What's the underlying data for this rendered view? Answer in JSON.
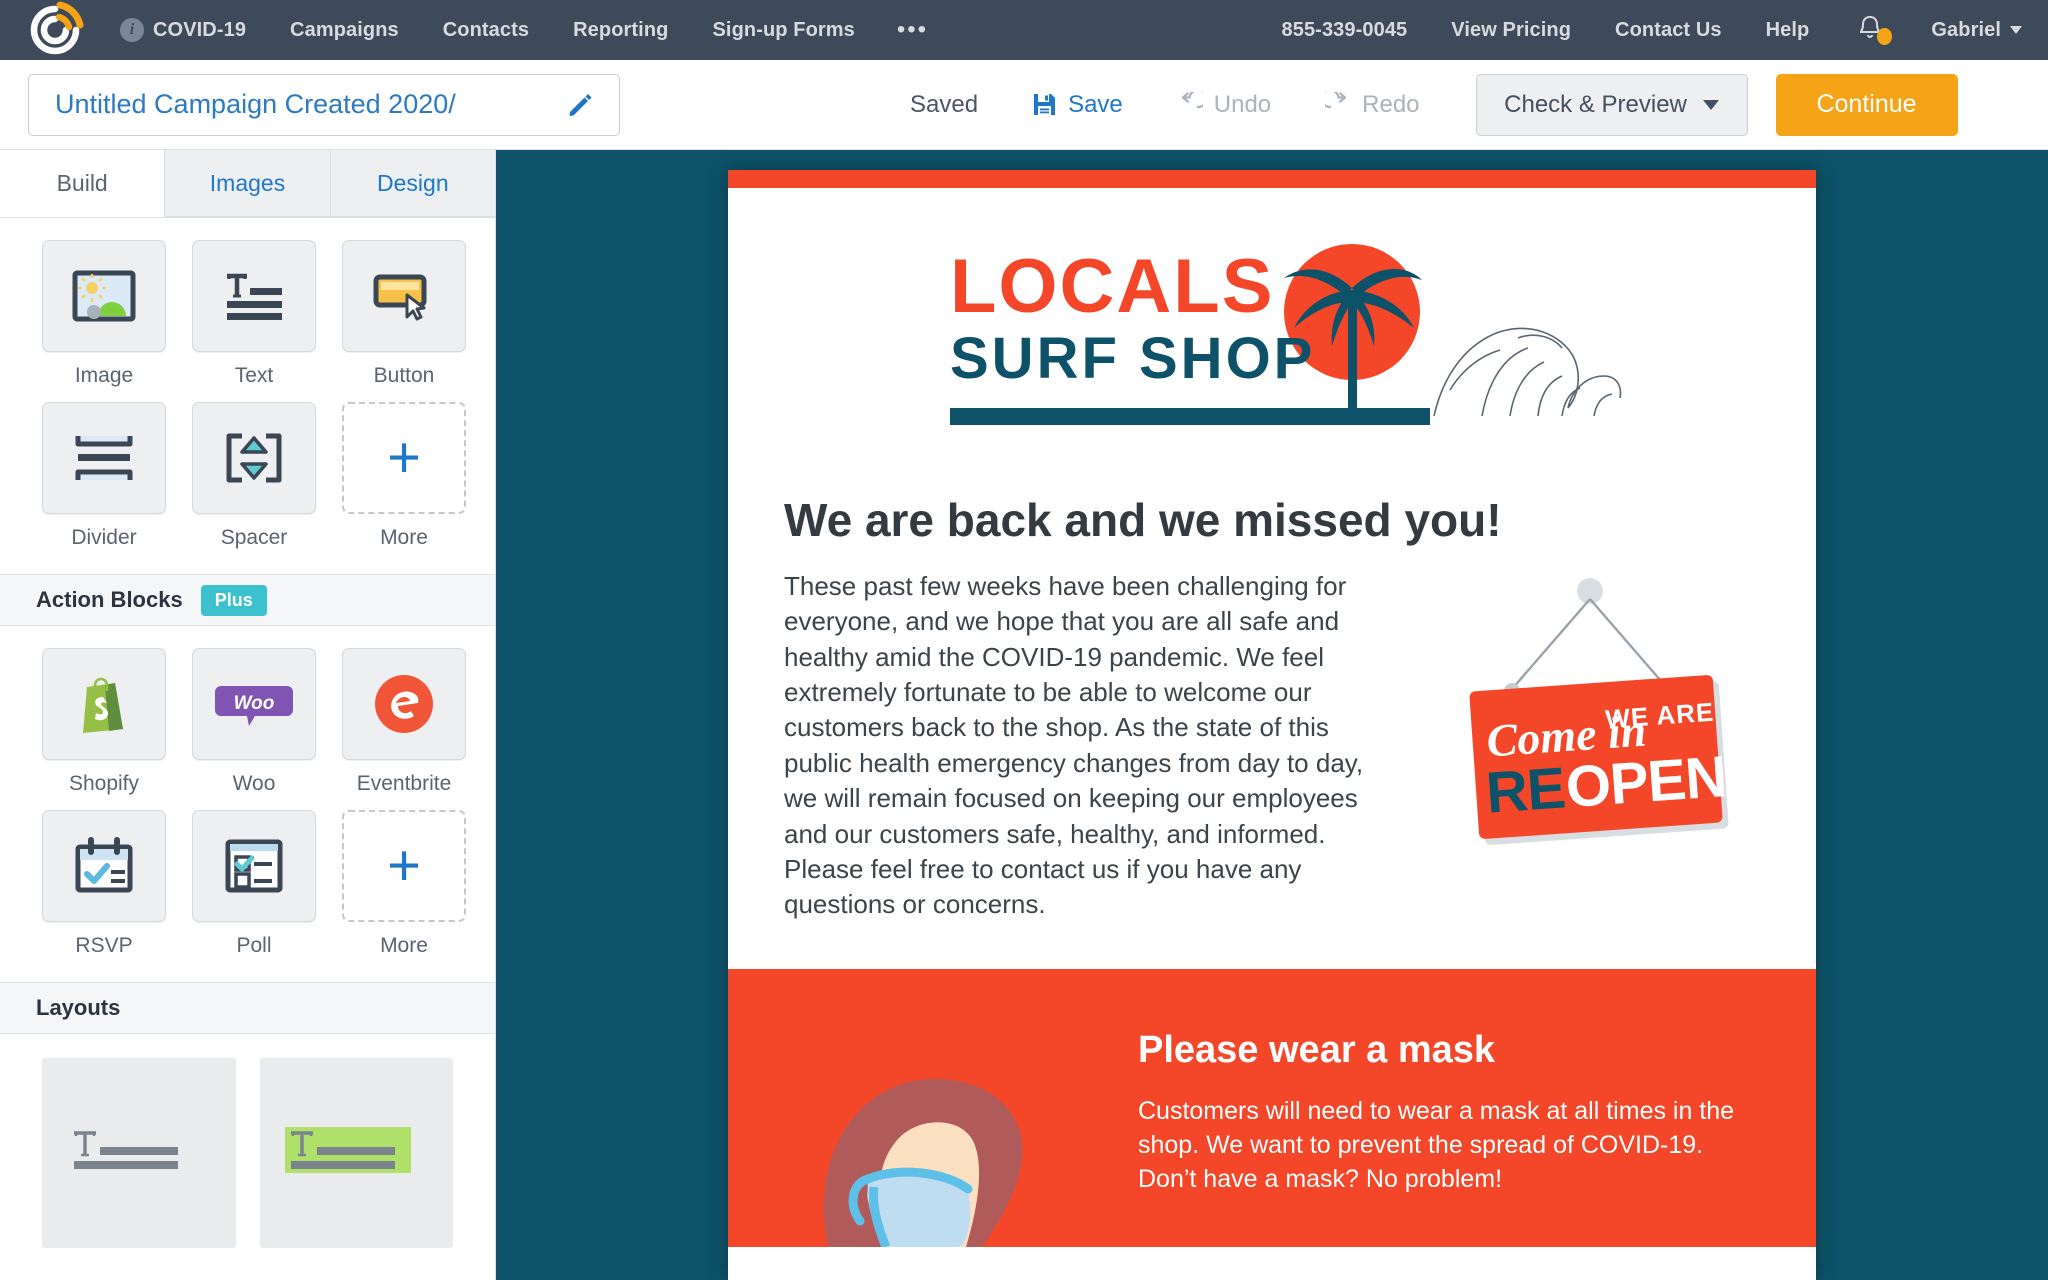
{
  "topnav": {
    "logo_icon": "constant-contact-spiral-logo",
    "left_items": [
      {
        "label": "COVID-19",
        "icon": "info-circle-icon"
      },
      {
        "label": "Campaigns"
      },
      {
        "label": "Contacts"
      },
      {
        "label": "Reporting"
      },
      {
        "label": "Sign-up Forms"
      },
      {
        "label": "•••",
        "icon": "more-menu-icon"
      }
    ],
    "right_items": [
      {
        "label": "855-339-0045"
      },
      {
        "label": "View Pricing"
      },
      {
        "label": "Contact Us"
      },
      {
        "label": "Help"
      }
    ],
    "bell_icon": "notification-bell-icon",
    "bell_has_badge": true,
    "user_name": "Gabriel",
    "bar_color": "#3E4A5A",
    "badge_color": "#F5A317"
  },
  "toolbar": {
    "campaign_title": "Untitled Campaign Created 2020/",
    "edit_icon": "pencil-icon",
    "saved_status": "Saved",
    "save_label": "Save",
    "save_icon": "floppy-disk-icon",
    "undo_label": "Undo",
    "undo_icon": "undo-arrow-icon",
    "undo_disabled": true,
    "redo_label": "Redo",
    "redo_icon": "redo-arrow-icon",
    "redo_disabled": true,
    "check_preview_label": "Check & Preview",
    "continue_label": "Continue",
    "continue_color": "#F5A317",
    "link_color": "#1F77C9"
  },
  "sidebar": {
    "tabs": [
      {
        "label": "Build",
        "active": true
      },
      {
        "label": "Images",
        "active": false
      },
      {
        "label": "Design",
        "active": false
      }
    ],
    "basic_blocks": [
      {
        "label": "Image",
        "icon": "image-block-icon"
      },
      {
        "label": "Text",
        "icon": "text-block-icon"
      },
      {
        "label": "Button",
        "icon": "button-block-icon"
      },
      {
        "label": "Divider",
        "icon": "divider-block-icon"
      },
      {
        "label": "Spacer",
        "icon": "spacer-block-icon"
      },
      {
        "label": "More",
        "icon": "plus-icon"
      }
    ],
    "action_section": {
      "title": "Action Blocks",
      "badge": "Plus",
      "badge_color": "#3CC2CE"
    },
    "action_blocks": [
      {
        "label": "Shopify",
        "icon": "shopify-bag-icon"
      },
      {
        "label": "Woo",
        "icon": "woocommerce-icon"
      },
      {
        "label": "Eventbrite",
        "icon": "eventbrite-icon"
      },
      {
        "label": "RSVP",
        "icon": "rsvp-calendar-icon"
      },
      {
        "label": "Poll",
        "icon": "poll-checklist-icon"
      },
      {
        "label": "More",
        "icon": "plus-icon"
      }
    ],
    "layouts_section": {
      "title": "Layouts"
    },
    "layouts": [
      {
        "icon": "layout-text-plain-thumbnail",
        "highlight": false
      },
      {
        "icon": "layout-text-highlighted-thumbnail",
        "highlight": true
      }
    ]
  },
  "canvas": {
    "background_color": "#0D5268",
    "email": {
      "accent_bar_color": "#F4472A",
      "logo": {
        "icon": "locals-surf-shop-logo",
        "word_top": "LOCALS",
        "word_bottom": "SURF SHOP",
        "top_color": "#F4472A",
        "bottom_color": "#0D5268"
      },
      "headline": "We are back and we missed you!",
      "paragraph": "These past few weeks have been challenging for everyone, and we hope that you are all safe and healthy amid the COVID-19 pandemic. We feel extremely fortunate to be able to welcome our customers back to the shop. As the state of this public health emergency changes from day to day, we will remain focused on keeping our employees and our customers safe, healthy, and informed. Please feel free to contact us if you have any questions or concerns.",
      "reopen_sign": {
        "icon": "reopen-hanging-sign-icon",
        "line1": "Come in",
        "line2": "WE ARE",
        "line3": "REOPEN",
        "sign_color": "#F4472A"
      },
      "mask_section": {
        "background_color": "#F4472A",
        "illustration_icon": "person-wearing-mask-illustration",
        "heading": "Please wear a mask",
        "text": "Customers will need to wear a mask at all times in the shop. We want to prevent the spread of COVID-19. Don’t have a mask? No problem!"
      }
    }
  }
}
